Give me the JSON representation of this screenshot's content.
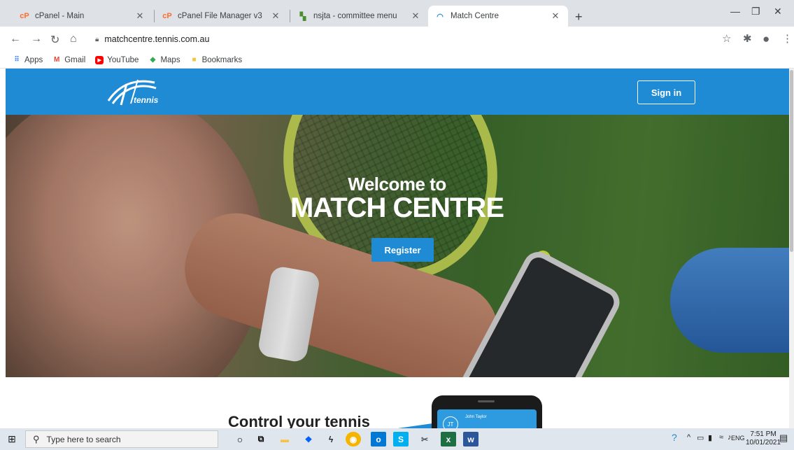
{
  "browser": {
    "tabs": [
      {
        "title": "cPanel - Main",
        "favicon": "cpanel-icon"
      },
      {
        "title": "cPanel File Manager v3",
        "favicon": "cpanel-icon"
      },
      {
        "title": "nsjta - committee menu",
        "favicon": "nsjta-icon"
      },
      {
        "title": "Match Centre",
        "favicon": "tennis-logo-icon",
        "active": true
      }
    ],
    "url": "matchcentre.tennis.com.au",
    "bookmarks": [
      {
        "label": "Apps",
        "icon": "apps-grid-icon"
      },
      {
        "label": "Gmail",
        "icon": "gmail-icon"
      },
      {
        "label": "YouTube",
        "icon": "youtube-icon"
      },
      {
        "label": "Maps",
        "icon": "maps-icon"
      },
      {
        "label": "Bookmarks",
        "icon": "folder-icon"
      }
    ]
  },
  "site": {
    "logo_text": "tennis",
    "signin_label": "Sign in",
    "hero": {
      "welcome": "Welcome to",
      "title": "MATCH CENTRE",
      "register_label": "Register"
    },
    "section_heading": "Control your tennis",
    "mock_app": {
      "initials": "JT",
      "user_name": "John Taylor"
    }
  },
  "taskbar": {
    "search_placeholder": "Type here to search",
    "language": "ENG",
    "time": "7:51 PM",
    "date": "10/01/2021"
  },
  "colors": {
    "brand_blue": "#1e8bd4",
    "tabstrip": "#dee1e6",
    "taskbar": "#dfe6ee"
  }
}
